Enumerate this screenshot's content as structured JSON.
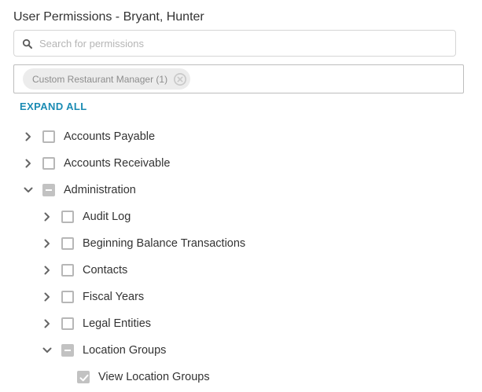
{
  "title": "User Permissions - Bryant, Hunter",
  "search": {
    "placeholder": "Search for permissions",
    "value": "",
    "icon": "search-icon"
  },
  "filter": {
    "chip_label": "Custom Restaurant Manager (1)",
    "chip_close_icon": "close-circle-icon"
  },
  "expand_all_label": "EXPAND ALL",
  "colors": {
    "accent": "#1a8bb3",
    "checkbox_filled": "#c2c2c2",
    "border": "#d6d6d6"
  },
  "tree": [
    {
      "label": "Accounts Payable",
      "level": 0,
      "expanded": false,
      "state": "unchecked"
    },
    {
      "label": "Accounts Receivable",
      "level": 0,
      "expanded": false,
      "state": "unchecked"
    },
    {
      "label": "Administration",
      "level": 0,
      "expanded": true,
      "state": "indeterminate"
    },
    {
      "label": "Audit Log",
      "level": 1,
      "expanded": false,
      "state": "unchecked"
    },
    {
      "label": "Beginning Balance Transactions",
      "level": 1,
      "expanded": false,
      "state": "unchecked"
    },
    {
      "label": "Contacts",
      "level": 1,
      "expanded": false,
      "state": "unchecked"
    },
    {
      "label": "Fiscal Years",
      "level": 1,
      "expanded": false,
      "state": "unchecked"
    },
    {
      "label": "Legal Entities",
      "level": 1,
      "expanded": false,
      "state": "unchecked"
    },
    {
      "label": "Location Groups",
      "level": 1,
      "expanded": true,
      "state": "indeterminate"
    },
    {
      "label": "View Location Groups",
      "level": 2,
      "expanded": null,
      "state": "checked"
    }
  ]
}
